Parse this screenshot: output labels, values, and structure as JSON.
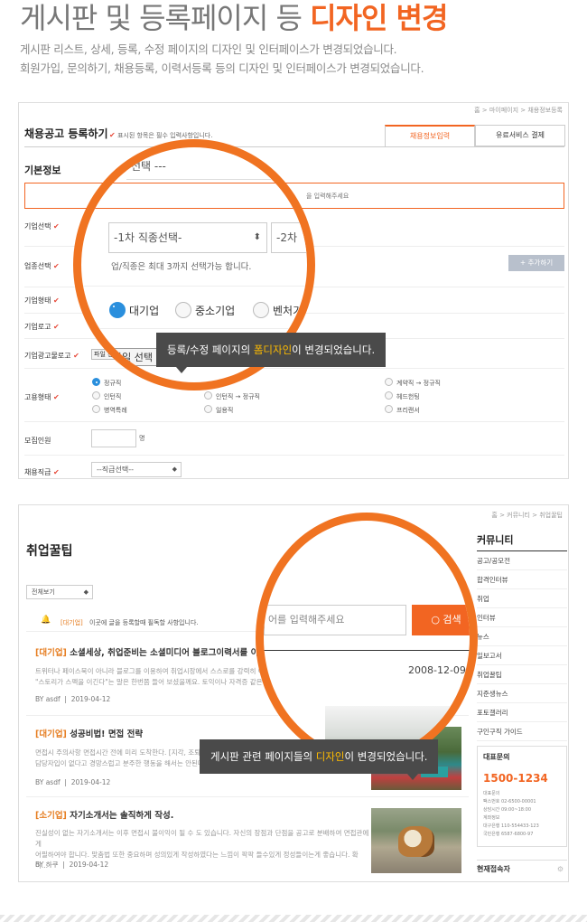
{
  "header": {
    "title_plain": "게시판 및 등록페이지 등 ",
    "title_accent": "디자인 변경",
    "desc1": "게시판 리스트, 상세, 등록, 수정 페이지의 디자인 및 인터페이스가 변경되었습니다.",
    "desc2": "회원가입, 문의하기, 채용등록, 이력서등록 등의 디자인 및 인터페이스가 변경되었습니다."
  },
  "form_panel": {
    "breadcrumb": "홈 > 마이페이지 > 채용정보등록",
    "title": "채용공고 등록하기",
    "required_note": "표시된 항목은 필수 입력사항입니다.",
    "tabs": [
      "채용정보입력",
      "유료서비스 결제"
    ],
    "section": "기본정보",
    "placeholder_fragment": "을 입력해주세요",
    "labels": [
      "기업선택",
      "업종선택",
      "기업형태",
      "기업로고",
      "기업광고물로고",
      "고용형태",
      "모집인원",
      "채용직급"
    ],
    "add_button": "+ 추가하기",
    "file_button": "파일 선택",
    "emp_types": [
      "정규직",
      "계약직 → 정규직",
      "인턴직",
      "인턴직 → 정규직",
      "헤드헌팅",
      "병역특례",
      "일용직",
      "프리랜서"
    ],
    "headcount_unit": "명",
    "rank_select": "--직급선택--",
    "zoom": {
      "select_top": "선택 ---",
      "select_job1": "-1차 직종선택-",
      "select_job2": "-2차",
      "hint": "업/직종은 최대 3까지 선택가능 합니다.",
      "sizes": [
        "대기업",
        "중소기업",
        "벤처기업"
      ],
      "file_button": "파일 선택"
    },
    "tooltip_pre": "등록/수정 페이지의 ",
    "tooltip_accent": "폼디자인",
    "tooltip_post": "이 변경되었습니다."
  },
  "board_panel": {
    "breadcrumb": "홈 > 커뮤니티 > 취업꿀팁",
    "title": "취업꿀팁",
    "filter": "전체보기",
    "notice_brand": "[대기업]",
    "notice_text": "이곳에 글을 등록할때 필독할 사항입니다.",
    "posts": [
      {
        "category": "[대기업]",
        "title": "소셜세상, 취업준비는 소셜미디어 블로그이력서를 이용하",
        "body1": "트위터나 페이스북이 아니라 블로그를 이용하여 취업시장에서 스스로를 강력히 어",
        "body2": "\"스토리가 스펙을 이긴다\"는 말은 한번쯤 들어 보셨을께요. 토익이나 자격증 같은",
        "author": "BY asdf",
        "date": "2019-04-12"
      },
      {
        "category": "[대기업]",
        "title": "성공비법! 면접 전략",
        "body1": "면접시 주의사항 면접시간 전에 미리 도착한다. [지각, 조퇴등",
        "body2": "담당자입이 없다고 경망스럽고 분주한 행동을 해서는 안된다",
        "author": "BY asdf",
        "date": "2019-04-12"
      },
      {
        "category": "[소기업]",
        "title": "자기소개서는 솔직하게 작성.",
        "body1": "진실성이 없는 자기소개서는 이후 면접시 불이익이 될 수 도 있습니다. 자신의 장점과 단점을 공고로 분배하여 면접관에게",
        "body2": "어필하여야 합니다. 맞춤법 또한 중요하며 성의있게 작성하였다는 느낌이 팍팍 들수있게 정성들이는게 좋습니다. 확이...",
        "author": "BY 하쿠",
        "date": "2019-04-12"
      }
    ],
    "sidebar": {
      "title": "커뮤니티",
      "items": [
        "공고/공모전",
        "합격인터뷰",
        "취업",
        "인터뷰",
        "뉴스",
        "일보고서",
        "취업꿀팁",
        "지준생뉴스",
        "포토갤러리",
        "구인구직 가이드"
      ],
      "contact_title": "대표문의",
      "phone": "1500-1234",
      "contact_lines": [
        "대표문의",
        "팩스번호  02-6500-00001",
        "상담시간  09:00~18:00",
        "계좌정보",
        "대구은행  110-554433-123",
        "국민은행  6587-6800-97"
      ],
      "visitors": "현재접속자"
    },
    "zoom": {
      "search_placeholder": "어를 입력해주세요",
      "search_button": "검색",
      "date": "2008-12-09"
    },
    "tooltip_pre": "게시판 관련 페이지들의 ",
    "tooltip_accent": "디자인",
    "tooltip_post": "이 변경되었습니다."
  },
  "colors": {
    "accent": "#f26522",
    "ring": "#f07321",
    "tooltip_bg": "#4a4a4a",
    "tooltip_accent": "#ffbc00",
    "radio_on": "#2a8fdd"
  }
}
